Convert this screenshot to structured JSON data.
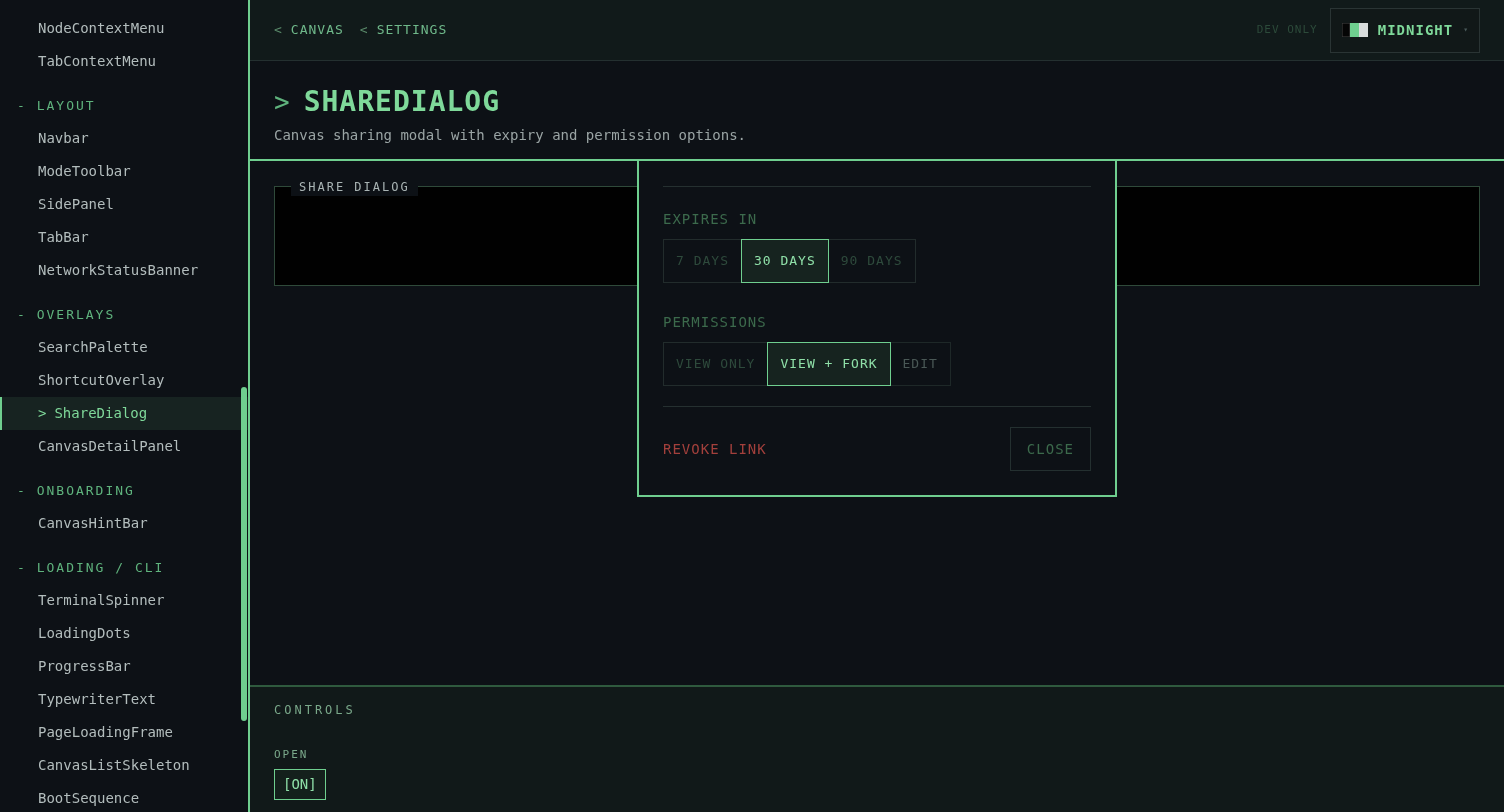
{
  "sidebar": {
    "groups": [
      {
        "items": [
          {
            "label": "NodeContextMenu",
            "selected": false
          },
          {
            "label": "TabContextMenu",
            "selected": false
          }
        ]
      },
      {
        "heading": "- LAYOUT",
        "items": [
          {
            "label": "Navbar",
            "selected": false
          },
          {
            "label": "ModeToolbar",
            "selected": false
          },
          {
            "label": "SidePanel",
            "selected": false
          },
          {
            "label": "TabBar",
            "selected": false
          },
          {
            "label": "NetworkStatusBanner",
            "selected": false
          }
        ]
      },
      {
        "heading": "- OVERLAYS",
        "items": [
          {
            "label": "SearchPalette",
            "selected": false
          },
          {
            "label": "ShortcutOverlay",
            "selected": false
          },
          {
            "label": "ShareDialog",
            "selected": true,
            "marker": ">"
          },
          {
            "label": "CanvasDetailPanel",
            "selected": false
          }
        ]
      },
      {
        "heading": "- ONBOARDING",
        "items": [
          {
            "label": "CanvasHintBar",
            "selected": false
          }
        ]
      },
      {
        "heading": "- LOADING / CLI",
        "items": [
          {
            "label": "TerminalSpinner",
            "selected": false
          },
          {
            "label": "LoadingDots",
            "selected": false
          },
          {
            "label": "ProgressBar",
            "selected": false
          },
          {
            "label": "TypewriterText",
            "selected": false
          },
          {
            "label": "PageLoadingFrame",
            "selected": false
          },
          {
            "label": "CanvasListSkeleton",
            "selected": false
          },
          {
            "label": "BootSequence",
            "selected": false
          }
        ]
      }
    ]
  },
  "breadcrumbs": [
    {
      "arrow": "<",
      "label": "CANVAS"
    },
    {
      "arrow": "<",
      "label": "SETTINGS"
    }
  ],
  "dev_label": "DEV ONLY",
  "theme_select": {
    "value": "MIDNIGHT",
    "caret": "▾"
  },
  "page": {
    "prompt": ">",
    "title": "SHAREDIALOG",
    "description": "Canvas sharing modal with expiry and permission options."
  },
  "preview": {
    "legend": "SHARE DIALOG"
  },
  "dialog": {
    "expires": {
      "label": "EXPIRES IN",
      "options": [
        {
          "label": "7 DAYS",
          "selected": false,
          "disabled": false
        },
        {
          "label": "30 DAYS",
          "selected": true,
          "disabled": false
        },
        {
          "label": "90 DAYS",
          "selected": false,
          "disabled": false
        }
      ]
    },
    "permissions": {
      "label": "PERMISSIONS",
      "options": [
        {
          "label": "VIEW ONLY",
          "selected": false,
          "disabled": false
        },
        {
          "label": "VIEW + FORK",
          "selected": true,
          "disabled": false
        },
        {
          "label": "EDIT",
          "selected": false,
          "disabled": true
        }
      ]
    },
    "revoke": "REVOKE LINK",
    "close": "CLOSE"
  },
  "controls": {
    "title": "CONTROLS",
    "items": [
      {
        "label": "OPEN",
        "value": "[ON]",
        "on": true
      }
    ]
  }
}
